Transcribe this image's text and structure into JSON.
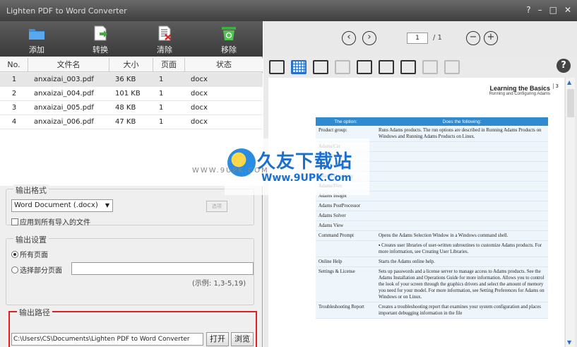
{
  "window": {
    "title": "Lighten PDF to Word Converter",
    "controls": [
      "?",
      "–",
      "□",
      "✕"
    ]
  },
  "toolbar": {
    "add": "添加",
    "convert": "转换",
    "clear": "清除",
    "remove": "移除"
  },
  "table": {
    "headers": [
      "No.",
      "文件名",
      "大小",
      "页面",
      "状态"
    ],
    "rows": [
      {
        "no": "1",
        "name": "anxaizai_003.pdf",
        "size": "36 KB",
        "pages": "1",
        "state": "docx"
      },
      {
        "no": "2",
        "name": "anxaizai_004.pdf",
        "size": "101 KB",
        "pages": "1",
        "state": "docx"
      },
      {
        "no": "3",
        "name": "anxaizai_005.pdf",
        "size": "48 KB",
        "pages": "1",
        "state": "docx"
      },
      {
        "no": "4",
        "name": "anxaizai_006.pdf",
        "size": "47 KB",
        "pages": "1",
        "state": "docx"
      }
    ]
  },
  "output_format": {
    "legend": "输出格式",
    "selected": "Word Document (.docx)",
    "apply_all": "应用到所有导入的文件",
    "settings_button": "选项"
  },
  "output_settings": {
    "legend": "输出设置",
    "all_pages": "所有页面",
    "some_pages": "选择部分页面",
    "range_value": "",
    "example": "(示例: 1,3-5,19)"
  },
  "output_path": {
    "legend": "输出路径",
    "value": "C:\\Users\\CS\\Documents\\Lighten PDF to Word Converter",
    "open": "打开",
    "browse": "浏览"
  },
  "preview": {
    "prev": "‹",
    "next": "›",
    "page": "1",
    "total": "/ 1",
    "zoom_out": "−",
    "zoom_in": "+",
    "help": "?",
    "doc_header_title": "Learning the Basics",
    "doc_header_sub": "Running and Configuring Adams",
    "doc_page": "3",
    "table_head": [
      "The option:",
      "Does the following:"
    ],
    "table_rows": [
      {
        "opt": "Product group:",
        "desc": "Runs Adams products. The run options are described in Running Adams Products on Windows and Running Adams Products on Linux."
      },
      {
        "opt": "Adams/Car",
        "desc": ""
      },
      {
        "opt": "Adams/Chassis",
        "desc": ""
      },
      {
        "opt": "Adams/Controls",
        "desc": ""
      },
      {
        "opt": "Adams/Durability",
        "desc": ""
      },
      {
        "opt": "Adams/Flex",
        "desc": ""
      },
      {
        "opt": "Adams Insight",
        "desc": ""
      },
      {
        "opt": "Adams PostProcessor",
        "desc": ""
      },
      {
        "opt": "Adams Solver",
        "desc": ""
      },
      {
        "opt": "Adams View",
        "desc": ""
      },
      {
        "opt": "Command Prompt",
        "desc": "Opens the Adams Selection Window in a Windows command shell."
      },
      {
        "opt": "",
        "desc": "▪ Creates user libraries of user-written subroutines to customize Adams products. For more information, see Creating User Libraries."
      },
      {
        "opt": "Online Help",
        "desc": "Starts the Adams online help."
      },
      {
        "opt": "Settings & License",
        "desc": "Sets up passwords and a license server to manage access to Adams products. See the Adams Installation and Operations Guide for more information. Allows you to control the look of your screen through the graphics drivers and select the amount of memory you need for your model. For more information, see Setting Preferences for Adams on Windows or on Linux."
      },
      {
        "opt": "Troubleshooting Report",
        "desc": "Creates a troubleshooting report that examines your system configuration and places important debugging information in the file"
      }
    ]
  },
  "watermark": {
    "cn": "久友下载站",
    "url": "Www.9UPK.Com",
    "small": "WWW.9UPK.COM"
  }
}
